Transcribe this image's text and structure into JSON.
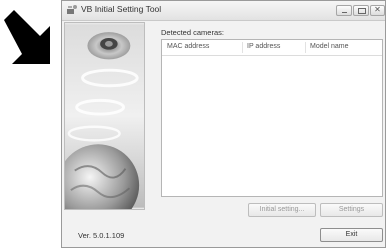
{
  "window": {
    "title": "VB Initial Setting Tool"
  },
  "main": {
    "detected_label": "Detected cameras:",
    "columns": [
      "MAC address",
      "IP address",
      "Model name"
    ]
  },
  "buttons": {
    "initial_setting": "Initial setting...",
    "settings": "Settings",
    "exit": "Exit"
  },
  "footer": {
    "version": "Ver. 5.0.1.109"
  },
  "icons": {
    "pointer": "arrow-pointer-icon",
    "app": "camera-app-icon",
    "minimize": "minimize-icon",
    "maximize": "maximize-icon",
    "close": "close-icon"
  },
  "colors": {
    "window_bg": "#f2f2f2",
    "arrow": "#000000"
  }
}
